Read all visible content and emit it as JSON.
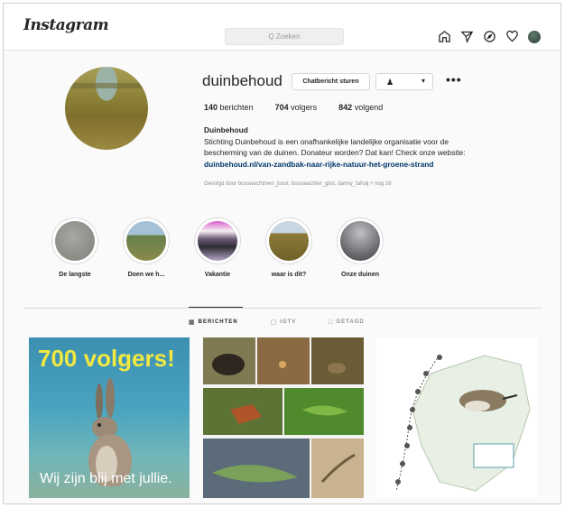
{
  "app": {
    "logo": "Instagram"
  },
  "search": {
    "placeholder": "Q Zoeken"
  },
  "nav": {
    "icons": [
      "home-icon",
      "send-icon",
      "compass-icon",
      "heart-icon",
      "avatar"
    ]
  },
  "profile": {
    "username": "duinbehoud",
    "message_button": "Chatbericht sturen",
    "more": "•••",
    "stats": {
      "posts": "140",
      "posts_label": "berichten",
      "followers": "704",
      "followers_label": "volgers",
      "following": "842",
      "following_label": "volgend"
    },
    "bio": {
      "name": "Duinbehoud",
      "line1": "Stichting Duinbehoud is een onafhankelijke landelijke organisatie voor de",
      "line2": "bescherming van de duinen. Donateur worden? Dat kan! Check onze website:",
      "link": "duinbehoud.nl/van-zandbak-naar-rijke-natuur-het-groene-strand"
    },
    "followed_by": "Gevolgd door bosswachtmen_joost, bosswachter_gins, danny_fahoij + nog 16"
  },
  "highlights": [
    {
      "label": "De langste"
    },
    {
      "label": "Doen we h..."
    },
    {
      "label": "Vakantie"
    },
    {
      "label": "waar is dit?"
    },
    {
      "label": "Onze duinen"
    }
  ],
  "tabs": [
    {
      "label": "BERICHTEN",
      "active": true
    },
    {
      "label": "IGTV",
      "active": false
    },
    {
      "label": "GETAGD",
      "active": false
    }
  ],
  "posts": {
    "first": {
      "headline": "700 volgers!",
      "footer": "Wij zijn blij met jullie."
    }
  },
  "colors": {
    "link": "#00376b",
    "headline_yellow": "#f1e842"
  }
}
